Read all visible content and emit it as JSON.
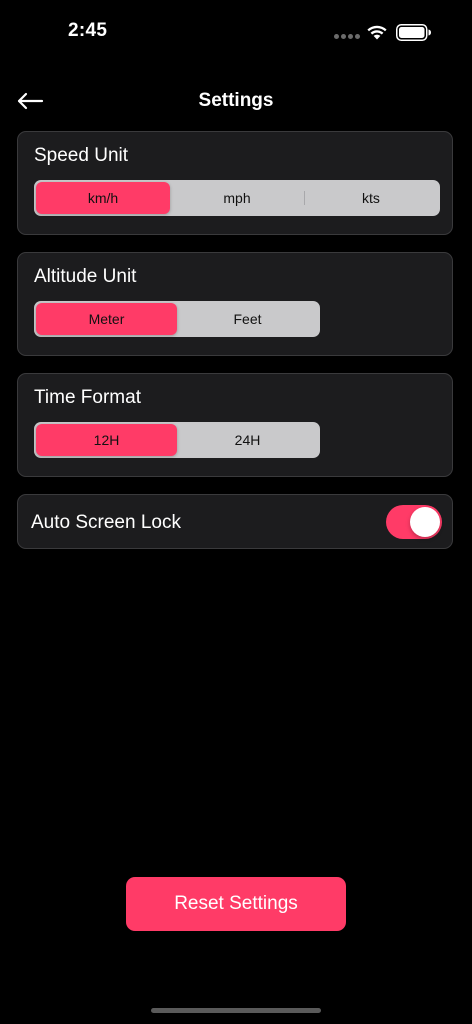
{
  "status_bar": {
    "time": "2:45"
  },
  "nav": {
    "title": "Settings"
  },
  "speed_unit": {
    "title": "Speed Unit",
    "options": [
      "km/h",
      "mph",
      "kts"
    ],
    "selected": "km/h"
  },
  "altitude_unit": {
    "title": "Altitude Unit",
    "options": [
      "Meter",
      "Feet"
    ],
    "selected": "Meter"
  },
  "time_format": {
    "title": "Time Format",
    "options": [
      "12H",
      "24H"
    ],
    "selected": "12H"
  },
  "auto_screen_lock": {
    "label": "Auto Screen Lock",
    "enabled": true
  },
  "reset": {
    "label": "Reset Settings"
  },
  "colors": {
    "accent": "#ff3b67",
    "card_background": "#1c1c1e",
    "segment_background": "#c9c9cb",
    "page_background": "#000000"
  }
}
